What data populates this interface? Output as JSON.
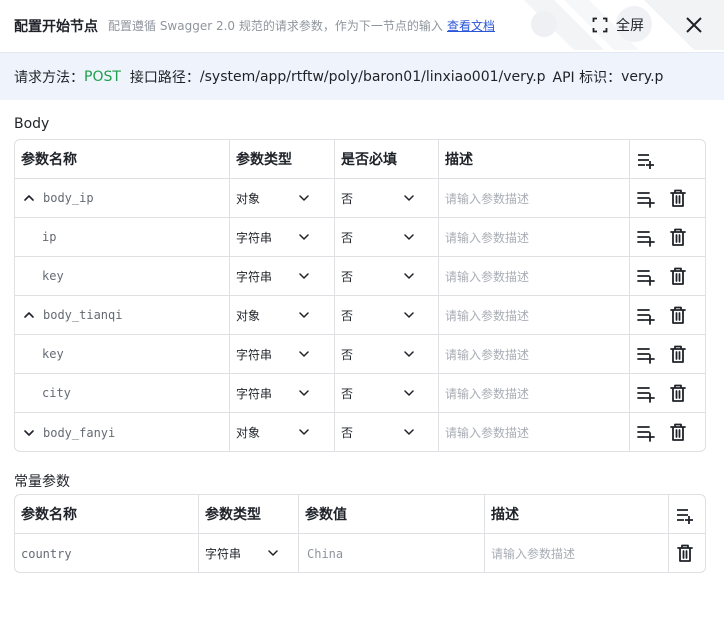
{
  "header": {
    "title": "配置开始节点",
    "description": "配置遵循 Swagger 2.0 规范的请求参数，作为下一节点的输入",
    "doc_link": "查看文档",
    "fullscreen_label": "全屏"
  },
  "info": {
    "method_label": "请求方法：",
    "method_value": "POST",
    "path_label": "接口路径：",
    "path_value": "/system/app/rtftw/poly/baron01/linxiao001/very.p",
    "api_label": "API 标识：",
    "api_value": "very.p"
  },
  "body_section": {
    "title": "Body",
    "headers": {
      "name": "参数名称",
      "type": "参数类型",
      "required": "是否必填",
      "desc": "描述"
    },
    "rows": [
      {
        "name": "body_ip",
        "type": "对象",
        "required": "否",
        "desc_placeholder": "请输入参数描述",
        "toggle": "expanded"
      },
      {
        "name": "ip",
        "type": "字符串",
        "required": "否",
        "desc_placeholder": "请输入参数描述"
      },
      {
        "name": "key",
        "type": "字符串",
        "required": "否",
        "desc_placeholder": "请输入参数描述"
      },
      {
        "name": "body_tianqi",
        "type": "对象",
        "required": "否",
        "desc_placeholder": "请输入参数描述",
        "toggle": "expanded"
      },
      {
        "name": "key",
        "type": "字符串",
        "required": "否",
        "desc_placeholder": "请输入参数描述"
      },
      {
        "name": "city",
        "type": "字符串",
        "required": "否",
        "desc_placeholder": "请输入参数描述"
      },
      {
        "name": "body_fanyi",
        "type": "对象",
        "required": "否",
        "desc_placeholder": "请输入参数描述",
        "toggle": "collapsed"
      }
    ]
  },
  "const_section": {
    "title": "常量参数",
    "headers": {
      "name": "参数名称",
      "type": "参数类型",
      "value": "参数值",
      "desc": "描述"
    },
    "rows": [
      {
        "name": "country",
        "type": "字符串",
        "value": "China",
        "desc_placeholder": "请输入参数描述"
      }
    ]
  },
  "colors": {
    "accent_link": "#2b56d8",
    "method_green": "#1e9e4a",
    "infobar_bg": "#eef3fc",
    "border": "#dee0e3"
  },
  "icons": [
    "fullscreen-icon",
    "close-icon",
    "add-child-icon",
    "delete-icon",
    "chevron-down-icon",
    "chevron-up-icon"
  ]
}
